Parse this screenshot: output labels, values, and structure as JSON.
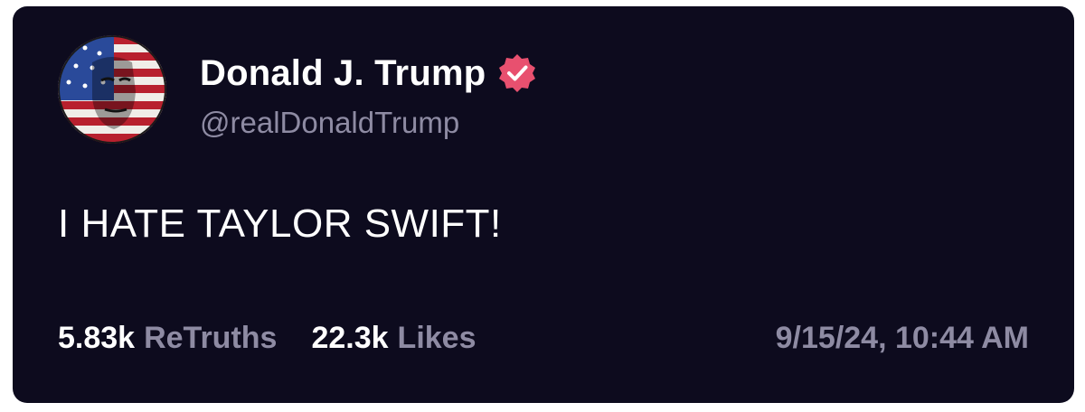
{
  "post": {
    "author": {
      "display_name": "Donald J. Trump",
      "handle": "@realDonaldTrump",
      "avatar_icon": "flag-portrait-avatar",
      "verified_icon": "verified-badge-icon",
      "verified_color": "#e8506f"
    },
    "text": "I HATE TAYLOR SWIFT!",
    "stats": {
      "retruths_count": "5.83k",
      "retruths_label": "ReTruths",
      "likes_count": "22.3k",
      "likes_label": "Likes"
    },
    "timestamp": "9/15/24, 10:44 AM"
  },
  "colors": {
    "background": "#0d0b1e",
    "primary_text": "#ffffff",
    "secondary_text": "#8e8ba3"
  }
}
